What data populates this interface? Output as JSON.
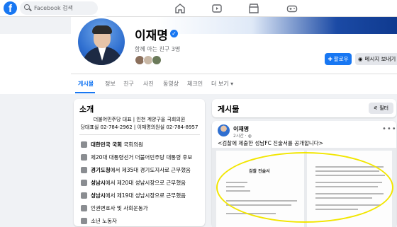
{
  "topbar": {
    "logo": "f",
    "search_placeholder": "Facebook 검색",
    "nav_icons": [
      "home-icon",
      "watch-icon",
      "marketplace-icon",
      "gaming-icon"
    ]
  },
  "profile": {
    "name": "이재명",
    "mutual_friends": "함께 아는 친구 3명",
    "follow_label": "팔로우",
    "message_label": "메시지 보내기"
  },
  "tabs": [
    "게시물",
    "정보",
    "친구",
    "사진",
    "동영상",
    "체크인",
    "더 보기 ▾"
  ],
  "intro": {
    "title": "소개",
    "bio_line1": "더불어민주당 대표  |  인천 계양구을 국회의원",
    "bio_line2": "당대표실 02-784-2962  |  이재명의원실 02-784-8957",
    "items": [
      {
        "bold": "대한민국 국회",
        "rest": " 국회의원"
      },
      {
        "bold": "",
        "rest": "제20대 대통령선거 더불어민주당 대통령 후보"
      },
      {
        "bold": "경기도청",
        "rest": "에서 제35대 경기도지사로 근무했음"
      },
      {
        "bold": "성남시",
        "rest": "에서 제20대 성남시장으로 근무했음"
      },
      {
        "bold": "성남시",
        "rest": "에서 제19대 성남시장으로 근무했음"
      },
      {
        "bold": "",
        "rest": "인권변호사 및 사회운동가"
      },
      {
        "bold": "",
        "rest": "소년 노동자"
      }
    ]
  },
  "feed": {
    "title": "게시물",
    "filter_label": "필터",
    "post": {
      "author": "이재명",
      "time": "2시간 · ",
      "text": "<검찰에 제출한 성남FC 진술서를 공개합니다>",
      "doc_title": "검찰 진술서"
    }
  },
  "colors": {
    "accent": "#1877f2",
    "highlight": "#f2e600"
  }
}
